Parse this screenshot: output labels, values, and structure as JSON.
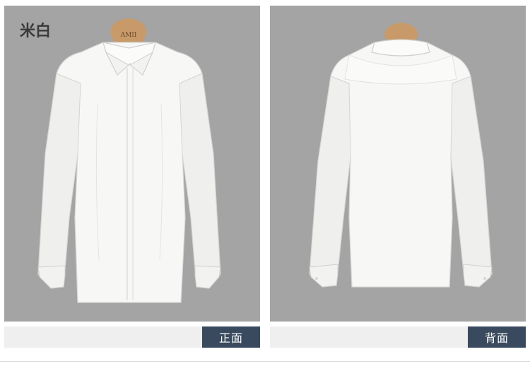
{
  "color_name": "米白",
  "hanger_brand": "AMII",
  "views": {
    "front_label": "正面",
    "back_label": "背面"
  },
  "colors": {
    "panel_bg": "#a4a4a4",
    "label_bg": "#3a4a5e",
    "shirt": "#f7f7f5",
    "hanger": "#c89a6a"
  }
}
